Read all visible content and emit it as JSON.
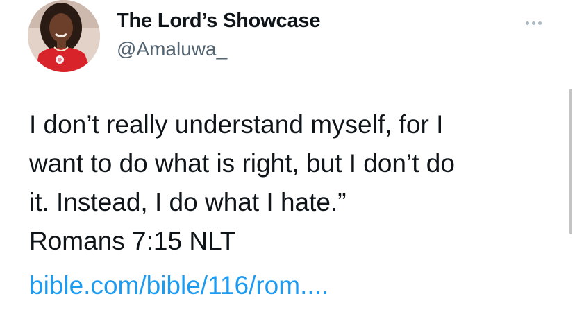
{
  "tweet": {
    "author": {
      "display_name": "The Lord’s Showcase",
      "handle": "@Amaluwa_"
    },
    "more_icon": "more-horizontal-icon",
    "text_lines": [
      "I don’t really understand myself, for I",
      "want to do what is right, but I don’t do",
      "it. Instead, I do what I hate.”",
      "Romans 7:15 NLT"
    ],
    "link_text": "bible.com/bible/116/rom...."
  },
  "colors": {
    "text": "#0f1419",
    "secondary_text": "#536471",
    "link": "#1d9bf0"
  }
}
